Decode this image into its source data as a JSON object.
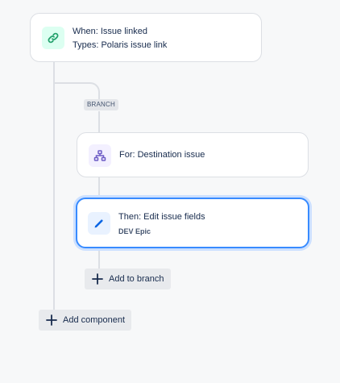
{
  "trigger": {
    "title": "When: Issue linked",
    "subtitle": "Types: Polaris issue link",
    "icon": "link-icon",
    "icon_color": "#22a06b",
    "icon_bg": "#dcfff1"
  },
  "branch": {
    "badge": "BRANCH",
    "condition": {
      "title": "For: Destination issue",
      "icon": "hierarchy-icon",
      "icon_color": "#6e5dc6",
      "icon_bg": "#f3f0ff"
    },
    "action": {
      "title": "Then: Edit issue fields",
      "subtitle": "DEV Epic",
      "icon": "pencil-icon",
      "icon_color": "#0c66e4",
      "icon_bg": "#e9f2ff",
      "selected": true
    },
    "add_label": "Add to branch"
  },
  "add_component_label": "Add component"
}
